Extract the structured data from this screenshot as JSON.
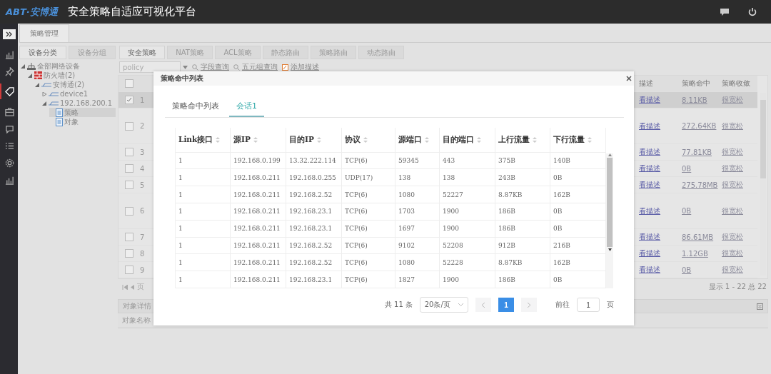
{
  "header": {
    "logo": "ABT·安博通",
    "title": "安全策略自适应可视化平台"
  },
  "sidebar": {
    "items": [
      {
        "kind": "chart",
        "selected": false
      },
      {
        "kind": "pin",
        "selected": false
      },
      {
        "kind": "tag",
        "selected": true
      },
      {
        "kind": "briefcase",
        "selected": false
      },
      {
        "kind": "chat",
        "selected": false
      },
      {
        "kind": "list",
        "selected": false
      },
      {
        "kind": "gear",
        "selected": false
      },
      {
        "kind": "chart",
        "selected": false
      }
    ]
  },
  "page_tab": "策略管理",
  "device_tabs": [
    {
      "label": "设备分类",
      "selected": true
    },
    {
      "label": "设备分组",
      "selected": false
    }
  ],
  "tree": [
    {
      "label": "全部网络设备",
      "kind": "network",
      "expanded": true,
      "selected": false,
      "children": [
        {
          "label": "防火墙(2)",
          "kind": "firewall",
          "expanded": true,
          "selected": false,
          "children": [
            {
              "label": "安博通(2)",
              "kind": "device",
              "expanded": true,
              "selected": false,
              "children": [
                {
                  "label": "device1",
                  "kind": "device",
                  "expanded": false,
                  "selected": false
                },
                {
                  "label": "192.168.200.1",
                  "kind": "device",
                  "expanded": true,
                  "selected": false,
                  "children": [
                    {
                      "label": "策略",
                      "kind": "file",
                      "selected": true
                    },
                    {
                      "label": "对象",
                      "kind": "file",
                      "selected": false
                    }
                  ]
                }
              ]
            }
          ]
        }
      ]
    }
  ],
  "policy_tabs": [
    {
      "label": "安全策略",
      "selected": true
    },
    {
      "label": "NAT策略",
      "selected": false
    },
    {
      "label": "ACL策略",
      "selected": false
    },
    {
      "label": "静态路由",
      "selected": false
    },
    {
      "label": "策略路由",
      "selected": false
    },
    {
      "label": "动态路由",
      "selected": false
    }
  ],
  "toolbar": {
    "select_value": "policy",
    "links": [
      "字段查询",
      "五元组查询",
      "添加描述"
    ]
  },
  "policy_table": {
    "all_checked": false,
    "columns": [
      "描述",
      "策略命中",
      "策略收敛"
    ],
    "rows": [
      {
        "number": "1",
        "checked": true,
        "description": "看描述",
        "hits": "8.11KB",
        "convergence": "很宽松"
      },
      {
        "number": "2",
        "checked": false,
        "description": "看描述",
        "hits": "272.64KB",
        "convergence": "很宽松"
      },
      {
        "number": "3",
        "checked": false,
        "description": "看描述",
        "hits": "77.81KB",
        "convergence": "很宽松"
      },
      {
        "number": "4",
        "checked": false,
        "description": "看描述",
        "hits": "0B",
        "convergence": "很宽松"
      },
      {
        "number": "5",
        "checked": false,
        "description": "看描述",
        "hits": "275.78MB",
        "convergence": "很宽松"
      },
      {
        "number": "6",
        "checked": false,
        "description": "看描述",
        "hits": "0B",
        "convergence": "很宽松"
      },
      {
        "number": "7",
        "checked": false,
        "description": "看描述",
        "hits": "86.61MB",
        "convergence": "很宽松"
      },
      {
        "number": "8",
        "checked": false,
        "description": "看描述",
        "hits": "1.12GB",
        "convergence": "很宽松"
      },
      {
        "number": "9",
        "checked": false,
        "description": "看描述",
        "hits": "0B",
        "convergence": "很宽松"
      }
    ]
  },
  "policy_pagination": {
    "page_label": "页",
    "summary": "显示 1 - 22 总 22"
  },
  "details": {
    "title": "对象详情",
    "column": "对象名称"
  },
  "modal": {
    "title": "策略命中列表",
    "tabs": [
      {
        "label": "策略命中列表",
        "selected": false
      },
      {
        "label": "会话1",
        "selected": true
      }
    ],
    "columns": [
      "Link接口",
      "源IP",
      "目的IP",
      "协议",
      "源端口",
      "目的端口",
      "上行流量",
      "下行流量"
    ],
    "rows": [
      [
        "1",
        "192.168.0.199",
        "13.32.222.114",
        "TCP(6)",
        "59345",
        "443",
        "375B",
        "140B"
      ],
      [
        "1",
        "192.168.0.211",
        "192.168.0.255",
        "UDP(17)",
        "138",
        "138",
        "243B",
        "0B"
      ],
      [
        "1",
        "192.168.0.211",
        "192.168.2.52",
        "TCP(6)",
        "1080",
        "52227",
        "8.87KB",
        "162B"
      ],
      [
        "1",
        "192.168.0.211",
        "192.168.23.1",
        "TCP(6)",
        "1703",
        "1900",
        "186B",
        "0B"
      ],
      [
        "1",
        "192.168.0.211",
        "192.168.23.1",
        "TCP(6)",
        "1697",
        "1900",
        "186B",
        "0B"
      ],
      [
        "1",
        "192.168.0.211",
        "192.168.2.52",
        "TCP(6)",
        "9102",
        "52208",
        "912B",
        "216B"
      ],
      [
        "1",
        "192.168.0.211",
        "192.168.2.52",
        "TCP(6)",
        "1080",
        "52228",
        "8.87KB",
        "162B"
      ],
      [
        "1",
        "192.168.0.211",
        "192.168.23.1",
        "TCP(6)",
        "1827",
        "1900",
        "186B",
        "0B"
      ]
    ],
    "pagination": {
      "total": "共 11 条",
      "page_size": "20条/页",
      "pages": [
        {
          "label": "1",
          "selected": true
        }
      ],
      "goto_label": "前往",
      "goto_value": "1",
      "page_suffix": "页"
    }
  }
}
